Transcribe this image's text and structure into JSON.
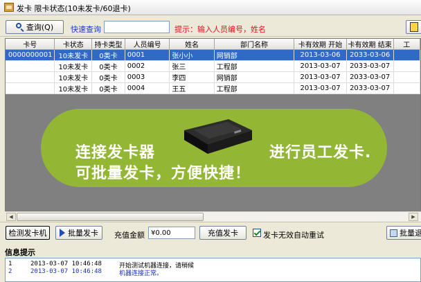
{
  "window": {
    "title": "发卡 限卡状态(10未发卡/60退卡)"
  },
  "toolbar": {
    "query_label": "查询(Q)",
    "quick_query_label": "快速查询",
    "quick_query_value": "",
    "hint": "提示：输入人员编号，姓名"
  },
  "grid": {
    "columns": [
      "卡号",
      "卡状态",
      "持卡类型",
      "人员编号",
      "姓名",
      "部门名称",
      "卡有效期 开始",
      "卡有效期 结束",
      "工"
    ],
    "rows": [
      [
        "0000000001",
        "10未发卡",
        "0类卡",
        "0001",
        "张小小",
        "网销部",
        "2013-03-06",
        "2033-03-06",
        ""
      ],
      [
        "",
        "10未发卡",
        "0类卡",
        "0002",
        "张三",
        "工程部",
        "2013-03-07",
        "2033-03-07",
        ""
      ],
      [
        "",
        "10未发卡",
        "0类卡",
        "0003",
        "李四",
        "网销部",
        "2013-03-07",
        "2033-03-07",
        ""
      ],
      [
        "",
        "10未发卡",
        "0类卡",
        "0004",
        "王五",
        "工程部",
        "2013-03-07",
        "2033-03-07",
        ""
      ]
    ],
    "selected_row": 0
  },
  "banner": {
    "line1_left": "连接发卡器",
    "line1_right": "进行员工发卡.",
    "line2": "可批量发卡，方便快捷！",
    "color": "#93b735"
  },
  "actions": {
    "detect_label": "检测发卡机",
    "batch_issue_label": "批量发卡",
    "amount_label": "充值金额",
    "amount_value": "¥0.00",
    "topup_label": "充值发卡",
    "auto_retry_label": "发卡无效自动重试",
    "auto_retry_checked": true,
    "batch_return_label": "批量退"
  },
  "info": {
    "title": "信息提示",
    "logs": [
      {
        "index": "1",
        "time": "2013-03-07 10:46:48",
        "message": "开始测试机器连接，请稍候",
        "color": "#000000"
      },
      {
        "index": "2",
        "time": "2013-03-07 10:46:48",
        "message": "机器连接正常。",
        "color": "#1a2fbf"
      }
    ]
  }
}
